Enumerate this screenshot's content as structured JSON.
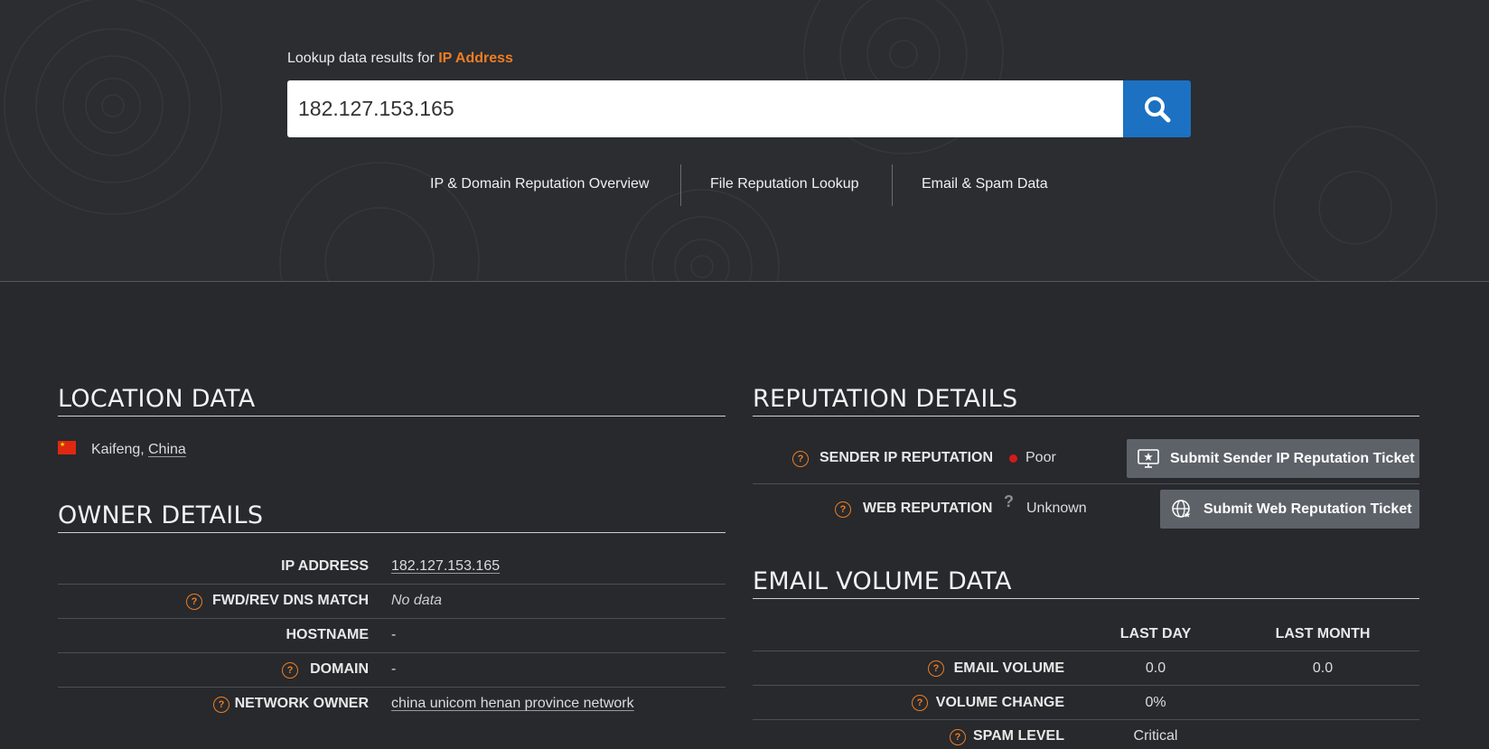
{
  "search": {
    "label_prefix": "Lookup data results for",
    "label_accent": "IP Address",
    "value": "182.127.153.165"
  },
  "nav": {
    "items": [
      "IP & Domain Reputation Overview",
      "File Reputation Lookup",
      "Email & Spam Data"
    ]
  },
  "location": {
    "title": "LOCATION DATA",
    "city": "Kaifeng,",
    "country": "China"
  },
  "owner": {
    "title": "OWNER DETAILS",
    "rows": [
      {
        "label": "IP ADDRESS",
        "value": "182.127.153.165"
      },
      {
        "label": "FWD/REV DNS MATCH",
        "value": "No data"
      },
      {
        "label": "HOSTNAME",
        "value": "-"
      },
      {
        "label": "DOMAIN",
        "value": "-"
      },
      {
        "label": "NETWORK OWNER",
        "value": "china unicom henan province network"
      }
    ]
  },
  "reputation": {
    "title": "REPUTATION DETAILS",
    "sender_label": "SENDER IP REPUTATION",
    "sender_value": "Poor",
    "sender_button": "Submit Sender IP Reputation Ticket",
    "web_label": "WEB REPUTATION",
    "web_value": "Unknown",
    "web_button": "Submit Web Reputation Ticket",
    "unknown_mark": "?"
  },
  "email_volume": {
    "title": "EMAIL VOLUME DATA",
    "headers": [
      "LAST DAY",
      "LAST MONTH"
    ],
    "rows": [
      {
        "label": "EMAIL VOLUME",
        "last_day": "0.0",
        "last_month": "0.0"
      },
      {
        "label": "VOLUME CHANGE",
        "last_day": "0%",
        "last_month": ""
      },
      {
        "label": "SPAM LEVEL",
        "last_day": "Critical",
        "last_month": ""
      }
    ]
  },
  "help_mark": "?",
  "colors": {
    "accent": "#ef7d22",
    "search_button": "#1c71c2",
    "poor": "#d61a1a",
    "ticket_button": "#5d6269"
  }
}
